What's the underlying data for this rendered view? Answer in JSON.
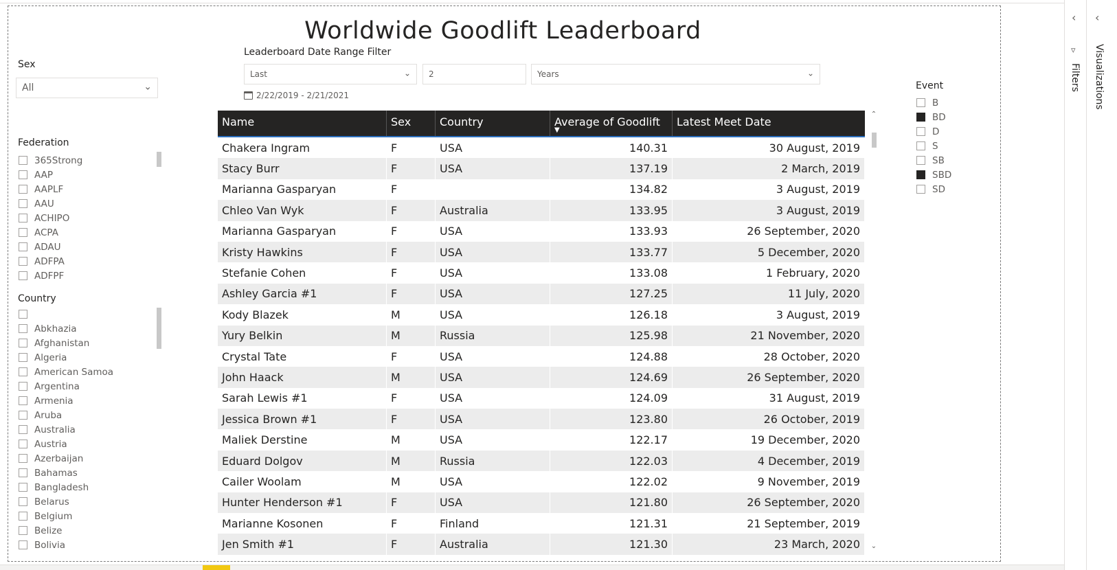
{
  "title": "Worldwide Goodlift Leaderboard",
  "sex_slicer": {
    "title": "Sex",
    "value": "All"
  },
  "federation_slicer": {
    "title": "Federation",
    "items": [
      "365Strong",
      "AAP",
      "AAPLF",
      "AAU",
      "ACHIPO",
      "ACPA",
      "ADAU",
      "ADFPA",
      "ADFPF"
    ]
  },
  "country_slicer": {
    "title": "Country",
    "items": [
      "",
      "Abkhazia",
      "Afghanistan",
      "Algeria",
      "American Samoa",
      "Argentina",
      "Armenia",
      "Aruba",
      "Australia",
      "Austria",
      "Azerbaijan",
      "Bahamas",
      "Bangladesh",
      "Belarus",
      "Belgium",
      "Belize",
      "Bolivia"
    ]
  },
  "date_filter": {
    "title": "Leaderboard Date Range Filter",
    "mode": "Last",
    "amount": "2",
    "unit": "Years",
    "range_text": "2/22/2019 - 2/21/2021"
  },
  "event_slicer": {
    "title": "Event",
    "items": [
      {
        "label": "B",
        "checked": false
      },
      {
        "label": "BD",
        "checked": true
      },
      {
        "label": "D",
        "checked": false
      },
      {
        "label": "S",
        "checked": false
      },
      {
        "label": "SB",
        "checked": false
      },
      {
        "label": "SBD",
        "checked": true
      },
      {
        "label": "SD",
        "checked": false
      }
    ]
  },
  "table": {
    "headers": [
      "Name",
      "Sex",
      "Country",
      "Average of Goodlift",
      "Latest Meet Date"
    ],
    "rows": [
      [
        "Chakera Ingram",
        "F",
        "USA",
        "140.31",
        "30 August, 2019"
      ],
      [
        "Stacy Burr",
        "F",
        "USA",
        "137.19",
        "2 March, 2019"
      ],
      [
        "Marianna Gasparyan",
        "F",
        "",
        "134.82",
        "3 August, 2019"
      ],
      [
        "Chleo Van Wyk",
        "F",
        "Australia",
        "133.95",
        "3 August, 2019"
      ],
      [
        "Marianna Gasparyan",
        "F",
        "USA",
        "133.93",
        "26 September, 2020"
      ],
      [
        "Kristy Hawkins",
        "F",
        "USA",
        "133.77",
        "5 December, 2020"
      ],
      [
        "Stefanie Cohen",
        "F",
        "USA",
        "133.08",
        "1 February, 2020"
      ],
      [
        "Ashley Garcia #1",
        "F",
        "USA",
        "127.25",
        "11 July, 2020"
      ],
      [
        "Kody Blazek",
        "M",
        "USA",
        "126.18",
        "3 August, 2019"
      ],
      [
        "Yury Belkin",
        "M",
        "Russia",
        "125.98",
        "21 November, 2020"
      ],
      [
        "Crystal Tate",
        "F",
        "USA",
        "124.88",
        "28 October, 2020"
      ],
      [
        "John Haack",
        "M",
        "USA",
        "124.69",
        "26 September, 2020"
      ],
      [
        "Sarah Lewis #1",
        "F",
        "USA",
        "124.09",
        "31 August, 2019"
      ],
      [
        "Jessica Brown #1",
        "F",
        "USA",
        "123.80",
        "26 October, 2019"
      ],
      [
        "Maliek Derstine",
        "M",
        "USA",
        "122.17",
        "19 December, 2020"
      ],
      [
        "Eduard Dolgov",
        "M",
        "Russia",
        "122.03",
        "4 December, 2019"
      ],
      [
        "Cailer Woolam",
        "M",
        "USA",
        "122.02",
        "9 November, 2019"
      ],
      [
        "Hunter Henderson #1",
        "F",
        "USA",
        "121.80",
        "26 September, 2020"
      ],
      [
        "Marianne Kosonen",
        "F",
        "Finland",
        "121.31",
        "21 September, 2019"
      ],
      [
        "Jen Smith #1",
        "F",
        "Australia",
        "121.30",
        "23 March, 2020"
      ]
    ]
  },
  "panes": {
    "filters": "Filters",
    "visualizations": "Visualizations"
  }
}
